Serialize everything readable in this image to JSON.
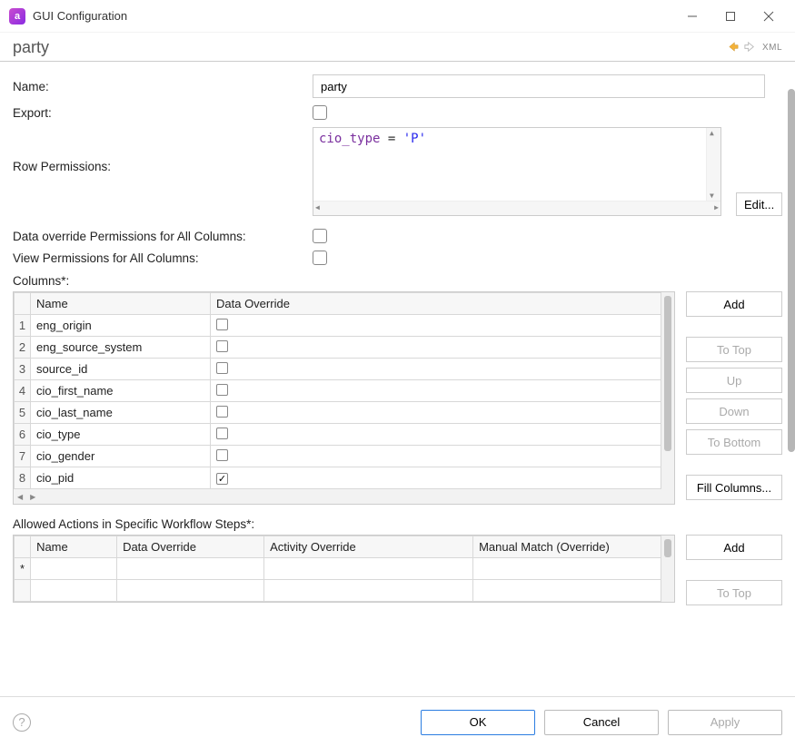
{
  "window": {
    "title": "GUI Configuration",
    "app_icon_letter": "a"
  },
  "header": {
    "page_title": "party",
    "xml_label": "XML"
  },
  "form": {
    "name_label": "Name:",
    "name_value": "party",
    "export_label": "Export:",
    "export_checked": false,
    "row_permissions_label": "Row Permissions:",
    "row_permissions_code": {
      "id": "cio_type",
      "eq": " = ",
      "str": "'P'"
    },
    "edit_button": "Edit...",
    "data_override_all_label": "Data override Permissions for All Columns:",
    "data_override_all_checked": false,
    "view_all_label": "View Permissions for All Columns:",
    "view_all_checked": false
  },
  "columns": {
    "section_label": "Columns*:",
    "headers": {
      "name": "Name",
      "data_override": "Data Override"
    },
    "rows": [
      {
        "n": 1,
        "name": "eng_origin",
        "override": false
      },
      {
        "n": 2,
        "name": "eng_source_system",
        "override": false
      },
      {
        "n": 3,
        "name": "source_id",
        "override": false
      },
      {
        "n": 4,
        "name": "cio_first_name",
        "override": false
      },
      {
        "n": 5,
        "name": "cio_last_name",
        "override": false
      },
      {
        "n": 6,
        "name": "cio_type",
        "override": false
      },
      {
        "n": 7,
        "name": "cio_gender",
        "override": false
      },
      {
        "n": 8,
        "name": "cio_pid",
        "override": true
      }
    ],
    "buttons": {
      "add": "Add",
      "to_top": "To Top",
      "up": "Up",
      "down": "Down",
      "to_bottom": "To Bottom",
      "fill": "Fill Columns..."
    }
  },
  "actions": {
    "section_label": "Allowed Actions in Specific Workflow Steps*:",
    "headers": {
      "name": "Name",
      "data_override": "Data Override",
      "activity_override": "Activity Override",
      "manual_match": "Manual Match (Override)"
    },
    "placeholder_row": "*",
    "buttons": {
      "add": "Add",
      "to_top": "To Top"
    }
  },
  "footer": {
    "ok": "OK",
    "cancel": "Cancel",
    "apply": "Apply"
  }
}
